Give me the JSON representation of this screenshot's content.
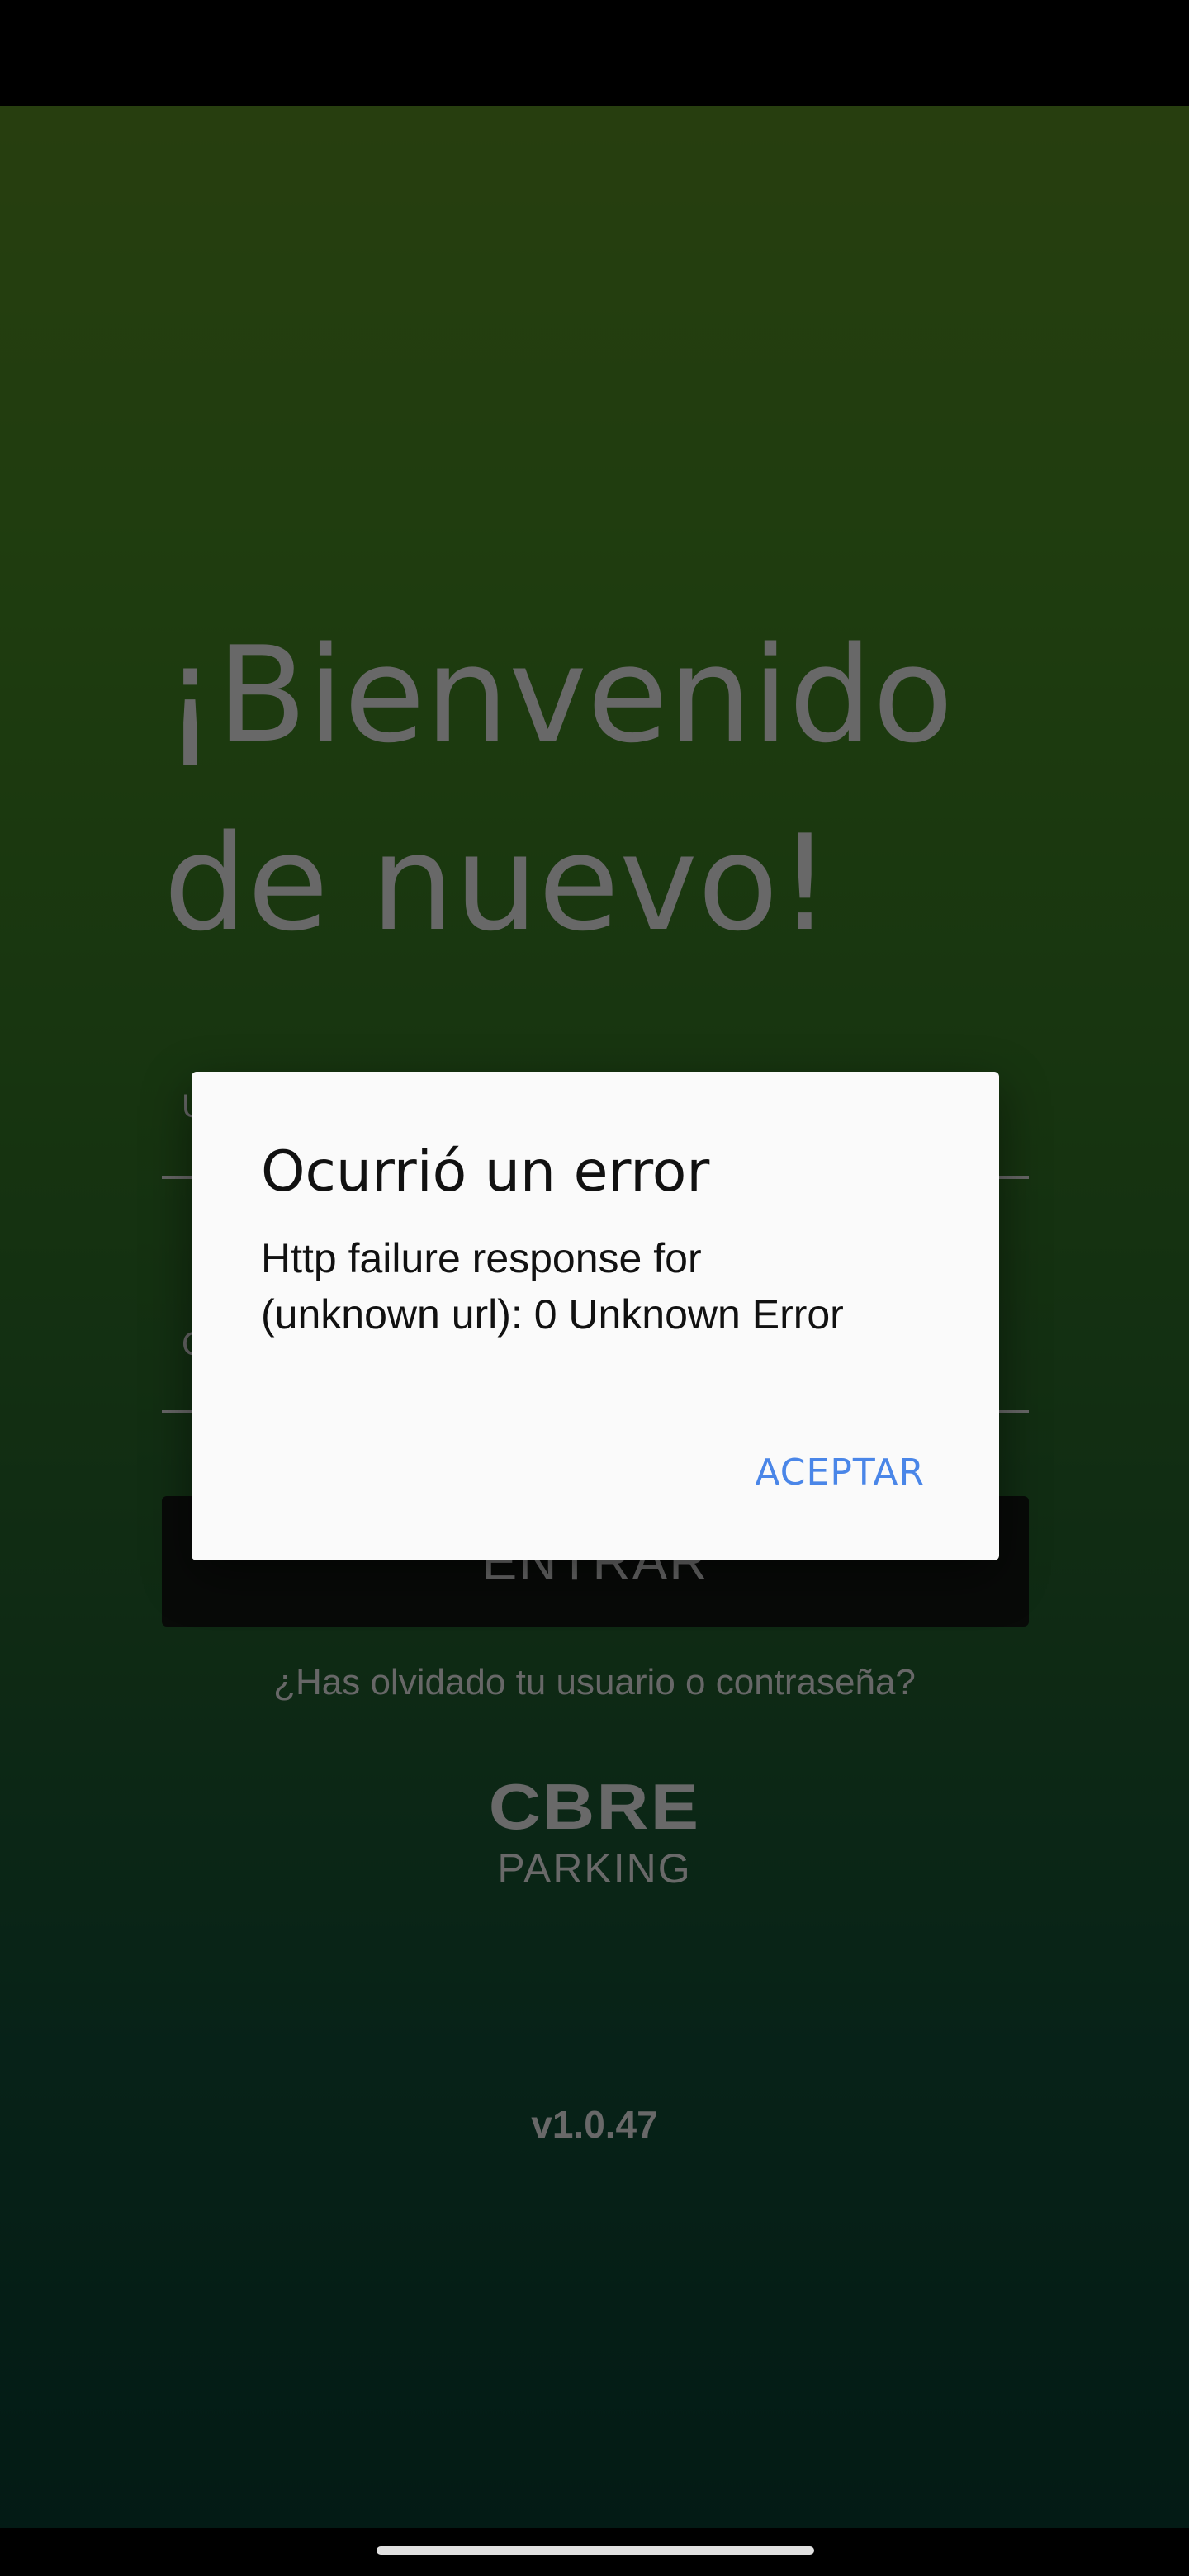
{
  "login": {
    "welcome_line1": "¡Bienvenido",
    "welcome_line2": "de nuevo!",
    "username_label": "U",
    "password_label": "C",
    "login_button": "ENTRAR",
    "forgot_link": "¿Has olvidado tu usuario o contraseña?",
    "logo_brand": "CBRE",
    "logo_product": "PARKING",
    "version": "v1.0.47"
  },
  "dialog": {
    "title": "Ocurrió un error",
    "message_line1": "Http failure response for",
    "message_line2": "(unknown url): 0 Unknown Error",
    "ok_button": "ACEPTAR"
  },
  "colors": {
    "accent": "#4a86e8",
    "background_top": "#4f7d1f",
    "background_bottom": "#07362a"
  }
}
